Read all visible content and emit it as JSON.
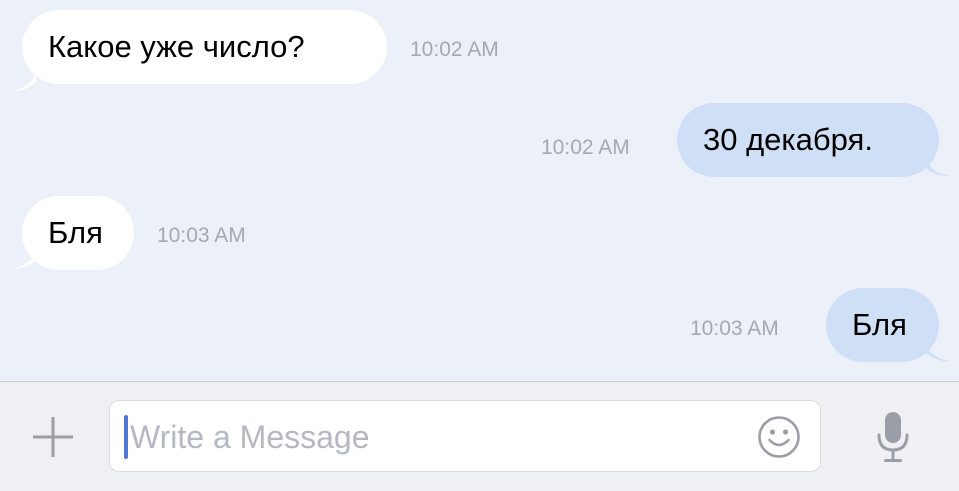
{
  "messages": [
    {
      "direction": "incoming",
      "text": "Какое уже число?",
      "time": "10:02 AM"
    },
    {
      "direction": "outgoing",
      "text": "30 декабря.",
      "time": "10:02 AM"
    },
    {
      "direction": "incoming",
      "text": "Бля",
      "time": "10:03 AM"
    },
    {
      "direction": "outgoing",
      "text": "Бля",
      "time": "10:03 AM"
    }
  ],
  "composer": {
    "placeholder": "Write a Message",
    "value": "",
    "icons": {
      "attach": "plus-icon",
      "emoji": "smiley-icon",
      "voice": "microphone-icon"
    }
  },
  "colors": {
    "background": "#ebf0f9",
    "incoming_bubble": "#ffffff",
    "outgoing_bubble": "#cfdff5",
    "timestamp": "#a3a8b1",
    "caret": "#4f78d4",
    "composer_bar": "#eff0f3",
    "icon_gray": "#9a9ea6"
  }
}
